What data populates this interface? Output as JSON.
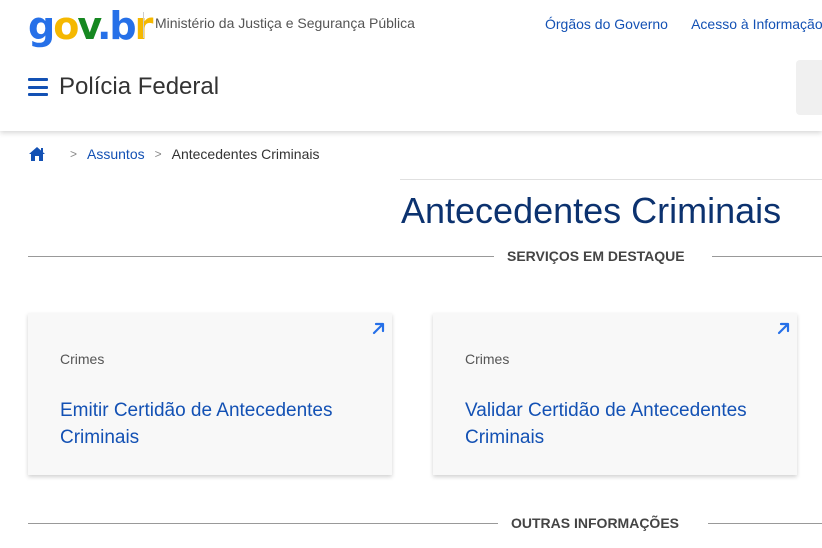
{
  "header": {
    "logo": {
      "g": "g",
      "o": "o",
      "v": "v",
      "dot": ".",
      "b": "b",
      "r": "r"
    },
    "ministry": "Ministério da Justiça e Segurança Pública",
    "top_links": [
      "Órgãos do Governo",
      "Acesso à Informação"
    ],
    "site_title": "Polícia Federal"
  },
  "breadcrumb": {
    "separator": ">",
    "items": [
      "Assuntos",
      "Antecedentes Criminais"
    ]
  },
  "page": {
    "title": "Antecedentes Criminais"
  },
  "sections": {
    "featured": "SERVIÇOS EM DESTAQUE",
    "other": "OUTRAS INFORMAÇÕES"
  },
  "cards": [
    {
      "category": "Crimes",
      "title": "Emitir Certidão de Antecedentes Criminais"
    },
    {
      "category": "Crimes",
      "title": "Validar Certidão de Antecedentes Criminais"
    }
  ],
  "colors": {
    "primary_blue": "#1351b4",
    "title_blue": "#0c326f",
    "logo_yellow": "#f5b800",
    "logo_green": "#168821"
  }
}
